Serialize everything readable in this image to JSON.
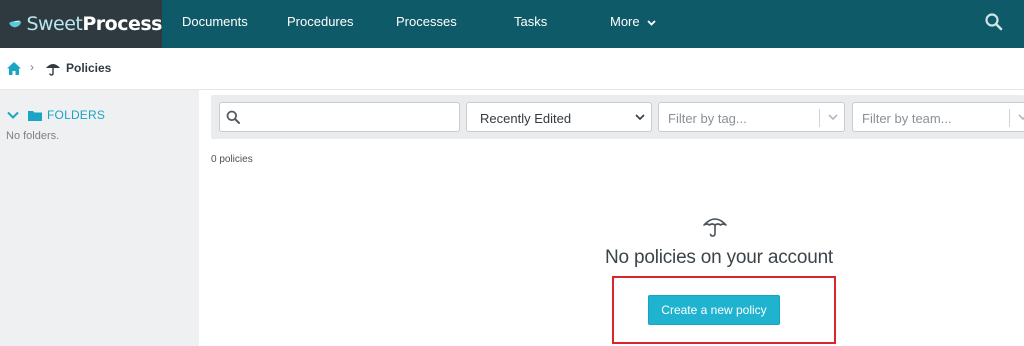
{
  "brand": {
    "name_part1": "Sweet",
    "name_part2": "Process"
  },
  "nav": {
    "items": [
      {
        "label": "Documents"
      },
      {
        "label": "Procedures"
      },
      {
        "label": "Processes"
      },
      {
        "label": "Tasks"
      },
      {
        "label": "More"
      }
    ]
  },
  "breadcrumb": {
    "current": "Policies"
  },
  "sidebar": {
    "folders_label": "FOLDERS",
    "empty_text": "No folders."
  },
  "filters": {
    "search_value": "",
    "sort_selected": "Recently Edited",
    "tag_placeholder": "Filter by tag...",
    "team_placeholder": "Filter by team..."
  },
  "results": {
    "count_text": "0 policies"
  },
  "empty_state": {
    "message": "No policies on your account",
    "button_label": "Create a new policy"
  },
  "colors": {
    "nav_bg": "#0f5a68",
    "brand_bg": "#2e3a40",
    "accent": "#1fb3d0",
    "sidebar_bg": "#eff0f1",
    "highlight": "#d9262c"
  },
  "icons": [
    "brand-logo-icon",
    "chevron-down-icon",
    "search-icon",
    "home-icon",
    "chevron-right-icon",
    "umbrella-icon",
    "folder-icon"
  ]
}
